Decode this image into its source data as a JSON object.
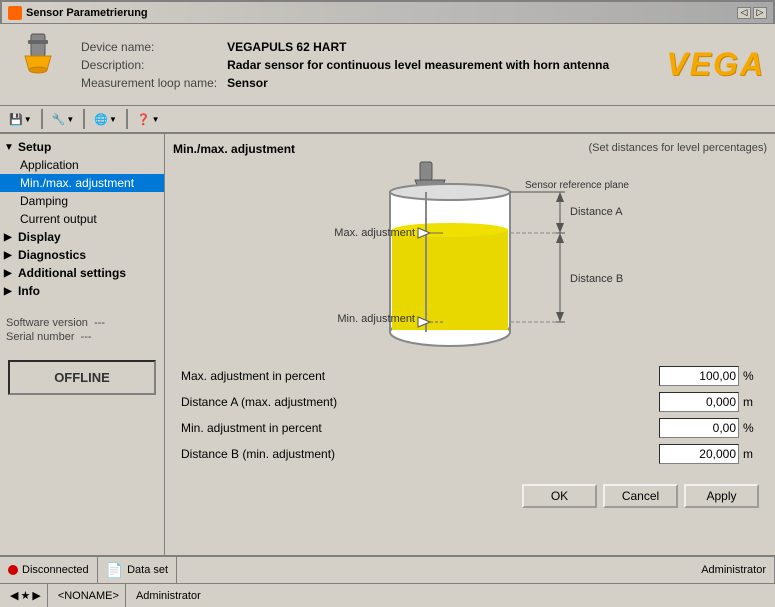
{
  "titlebar": {
    "title": "Sensor Parametrierung",
    "icon_color": "#ff6600"
  },
  "device_info": {
    "device_name_label": "Device name:",
    "device_name_value": "VEGAPULS 62 HART",
    "description_label": "Description:",
    "description_value": "Radar sensor for continuous level measurement with horn antenna",
    "loop_name_label": "Measurement loop name:",
    "loop_name_value": "Sensor",
    "logo": "VEGA"
  },
  "toolbar": {
    "buttons": [
      "💾",
      "🔧",
      "🌐",
      "❓"
    ]
  },
  "sidebar": {
    "items": [
      {
        "id": "setup",
        "label": "Setup",
        "level": 0,
        "expanded": true,
        "has_expand": true
      },
      {
        "id": "application",
        "label": "Application",
        "level": 1,
        "expanded": false,
        "has_expand": false
      },
      {
        "id": "min_max",
        "label": "Min./max. adjustment",
        "level": 1,
        "expanded": false,
        "has_expand": false,
        "selected": true
      },
      {
        "id": "damping",
        "label": "Damping",
        "level": 1,
        "expanded": false,
        "has_expand": false
      },
      {
        "id": "current_output",
        "label": "Current output",
        "level": 1,
        "expanded": false,
        "has_expand": false
      },
      {
        "id": "display",
        "label": "Display",
        "level": 0,
        "expanded": false,
        "has_expand": true
      },
      {
        "id": "diagnostics",
        "label": "Diagnostics",
        "level": 0,
        "expanded": false,
        "has_expand": true
      },
      {
        "id": "additional_settings",
        "label": "Additional settings",
        "level": 0,
        "expanded": false,
        "has_expand": true
      },
      {
        "id": "info",
        "label": "Info",
        "level": 0,
        "expanded": false,
        "has_expand": true
      }
    ],
    "software_version_label": "Software version",
    "software_version_value": "---",
    "serial_number_label": "Serial number",
    "serial_number_value": "---",
    "offline_button": "OFFLINE"
  },
  "diagram": {
    "title": "Min./max. adjustment",
    "subtitle": "(Set distances for level percentages)",
    "max_label": "Max. adjustment",
    "min_label": "Min. adjustment",
    "sensor_ref_label": "Sensor reference plane",
    "distance_a_label": "Distance A",
    "distance_b_label": "Distance B"
  },
  "parameters": [
    {
      "label": "Max. adjustment in percent",
      "value": "100,00",
      "unit": "%"
    },
    {
      "label": "Distance A (max. adjustment)",
      "value": "0,000",
      "unit": "m"
    },
    {
      "label": "Min. adjustment in percent",
      "value": "0,00",
      "unit": "%"
    },
    {
      "label": "Distance B (min. adjustment)",
      "value": "20,000",
      "unit": "m"
    }
  ],
  "buttons": {
    "ok": "OK",
    "cancel": "Cancel",
    "apply": "Apply"
  },
  "statusbar": {
    "disconnected": "Disconnected",
    "dataset": "Data set",
    "administrator": "Administrator"
  },
  "taskbar": {
    "noname": "<NONAME>",
    "administrator": "Administrator"
  }
}
